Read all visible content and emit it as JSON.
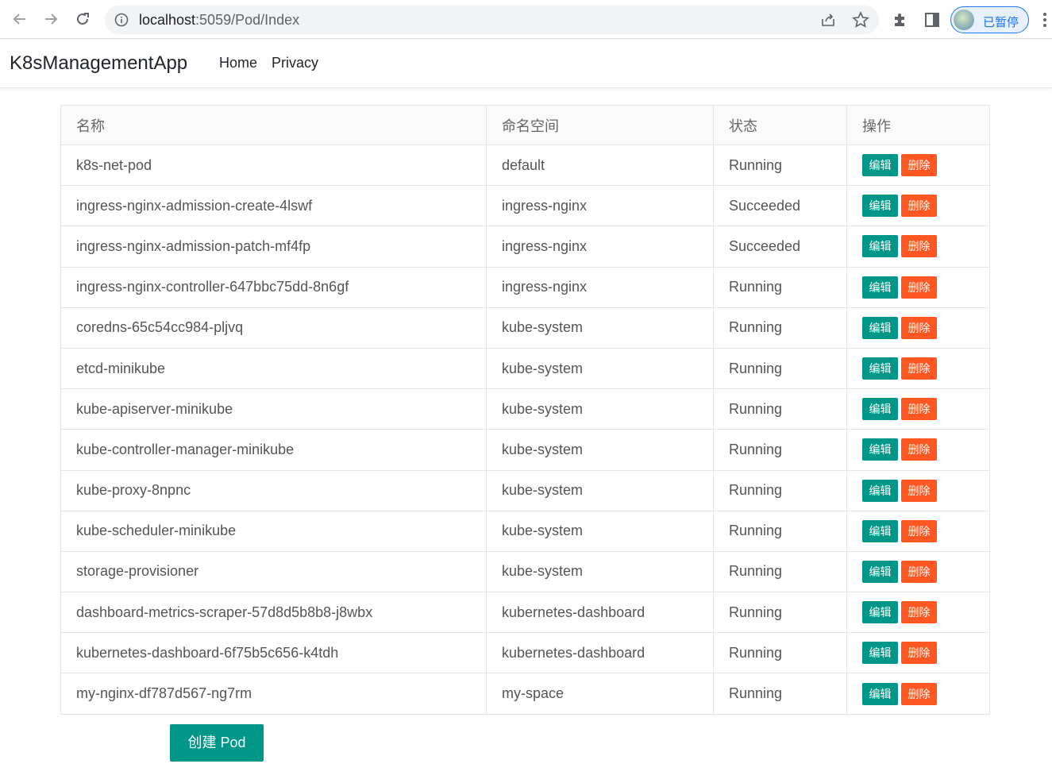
{
  "browser": {
    "url_host": "localhost",
    "url_rest": ":5059/Pod/Index",
    "profile_label": "已暂停"
  },
  "navbar": {
    "brand": "K8sManagementApp",
    "links": [
      "Home",
      "Privacy"
    ]
  },
  "table": {
    "headers": [
      "名称",
      "命名空间",
      "状态",
      "操作"
    ],
    "edit_label": "编辑",
    "delete_label": "删除",
    "rows": [
      {
        "name": "k8s-net-pod",
        "namespace": "default",
        "status": "Running"
      },
      {
        "name": "ingress-nginx-admission-create-4lswf",
        "namespace": "ingress-nginx",
        "status": "Succeeded"
      },
      {
        "name": "ingress-nginx-admission-patch-mf4fp",
        "namespace": "ingress-nginx",
        "status": "Succeeded"
      },
      {
        "name": "ingress-nginx-controller-647bbc75dd-8n6gf",
        "namespace": "ingress-nginx",
        "status": "Running"
      },
      {
        "name": "coredns-65c54cc984-pljvq",
        "namespace": "kube-system",
        "status": "Running"
      },
      {
        "name": "etcd-minikube",
        "namespace": "kube-system",
        "status": "Running"
      },
      {
        "name": "kube-apiserver-minikube",
        "namespace": "kube-system",
        "status": "Running"
      },
      {
        "name": "kube-controller-manager-minikube",
        "namespace": "kube-system",
        "status": "Running"
      },
      {
        "name": "kube-proxy-8npnc",
        "namespace": "kube-system",
        "status": "Running"
      },
      {
        "name": "kube-scheduler-minikube",
        "namespace": "kube-system",
        "status": "Running"
      },
      {
        "name": "storage-provisioner",
        "namespace": "kube-system",
        "status": "Running"
      },
      {
        "name": "dashboard-metrics-scraper-57d8d5b8b8-j8wbx",
        "namespace": "kubernetes-dashboard",
        "status": "Running"
      },
      {
        "name": "kubernetes-dashboard-6f75b5c656-k4tdh",
        "namespace": "kubernetes-dashboard",
        "status": "Running"
      },
      {
        "name": "my-nginx-df787d567-ng7rm",
        "namespace": "my-space",
        "status": "Running"
      }
    ]
  },
  "create_button": "创建 Pod",
  "colors": {
    "edit": "#009688",
    "delete": "#ff5722",
    "create": "#009688"
  }
}
